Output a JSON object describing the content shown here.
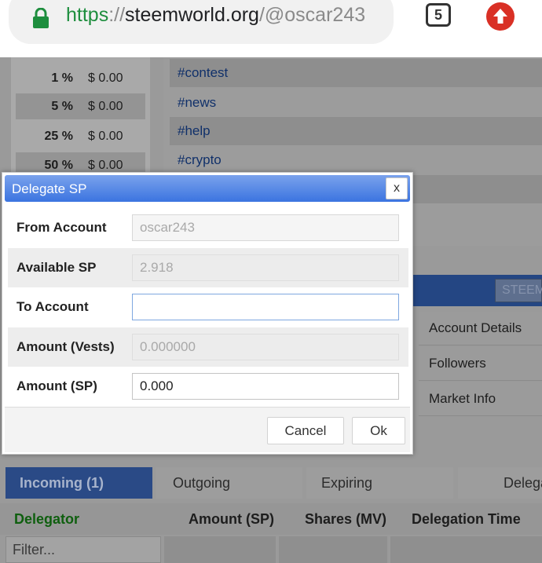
{
  "browser": {
    "url_scheme": "https",
    "url_sep": "://",
    "url_host": "steemworld.org",
    "url_path": "/@oscar243",
    "tab_count": "5"
  },
  "percent_rows": [
    {
      "pct": "1 %",
      "amount": "$ 0.00"
    },
    {
      "pct": "5 %",
      "amount": "$ 0.00"
    },
    {
      "pct": "25 %",
      "amount": "$ 0.00"
    },
    {
      "pct": "50 %",
      "amount": "$ 0.00"
    }
  ],
  "tags": [
    "#contest",
    "#news",
    "#help",
    "#crypto"
  ],
  "steem_button": "STEEM",
  "side_menu": [
    "Account Details",
    "Followers",
    "Market Info"
  ],
  "delegation_tabs": [
    "Incoming (1)",
    "Outgoing",
    "Expiring",
    "Delega"
  ],
  "delegation_table": {
    "headers": [
      "Delegator",
      "Amount (SP)",
      "Shares (MV)",
      "Delegation Time"
    ],
    "filter_placeholder": "Filter..."
  },
  "modal": {
    "title": "Delegate SP",
    "close_label": "x",
    "fields": [
      {
        "label": "From Account",
        "value": "oscar243"
      },
      {
        "label": "Available SP",
        "value": "2.918"
      },
      {
        "label": "To Account",
        "value": ""
      },
      {
        "label": "Amount (Vests)",
        "value": "0.000000"
      },
      {
        "label": "Amount (SP)",
        "value": "0.000"
      }
    ],
    "cancel_label": "Cancel",
    "ok_label": "Ok"
  },
  "colors": {
    "accent": "#3b74e0",
    "secure_green": "#1e8e3e",
    "delegator_green": "#0f5f0f",
    "update_red": "#d93025"
  }
}
